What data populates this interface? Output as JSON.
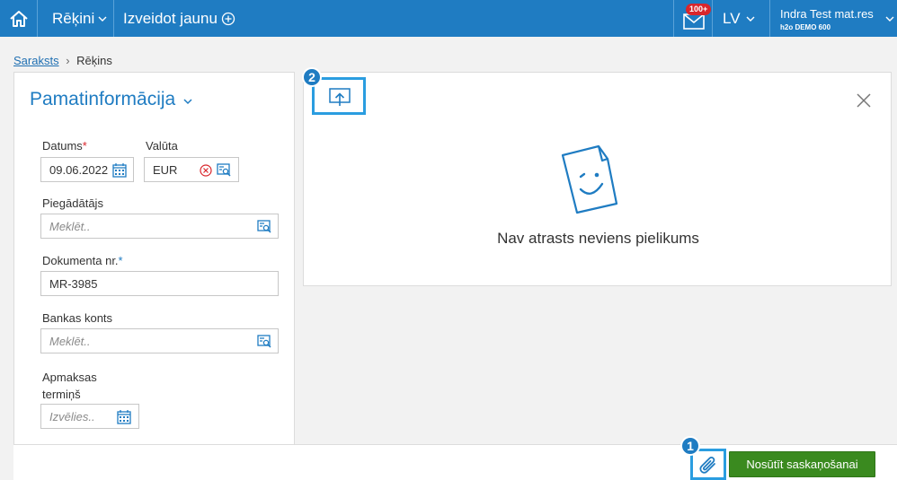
{
  "topbar": {
    "menu_label": "Rēķini",
    "create_label": "Izveidot jaunu",
    "notifications_badge": "100+",
    "language": "LV",
    "user_name": "Indra Test mat.res",
    "user_company": "h2o DEMO 600"
  },
  "breadcrumb": {
    "list_link": "Saraksts",
    "separator": "›",
    "current": "Rēķins"
  },
  "basic_info": {
    "title": "Pamatinformācija",
    "date_label": "Datums",
    "date_required": "*",
    "date_value": "09.06.2022",
    "currency_label": "Valūta",
    "currency_value": "EUR",
    "supplier_label": "Piegādātājs",
    "supplier_placeholder": "Meklēt..",
    "docnum_label": "Dokumenta nr.",
    "docnum_required": "*",
    "docnum_value": "MR-3985",
    "bank_label": "Bankas konts",
    "bank_placeholder": "Meklēt..",
    "payterm_label_line1": "Apmaksas",
    "payterm_label_line2": "termiņš",
    "payterm_placeholder": "Izvēlies.."
  },
  "attachments": {
    "empty_message": "Nav atrasts neviens pielikums"
  },
  "actions": {
    "send_label": "Nosūtīt saskaņošanai"
  },
  "callouts": {
    "one": "1",
    "two": "2"
  },
  "colors": {
    "primary": "#1f7cc2",
    "send_button": "#3a8a1f",
    "required": "#d9262c",
    "highlight": "#2a9de0"
  }
}
